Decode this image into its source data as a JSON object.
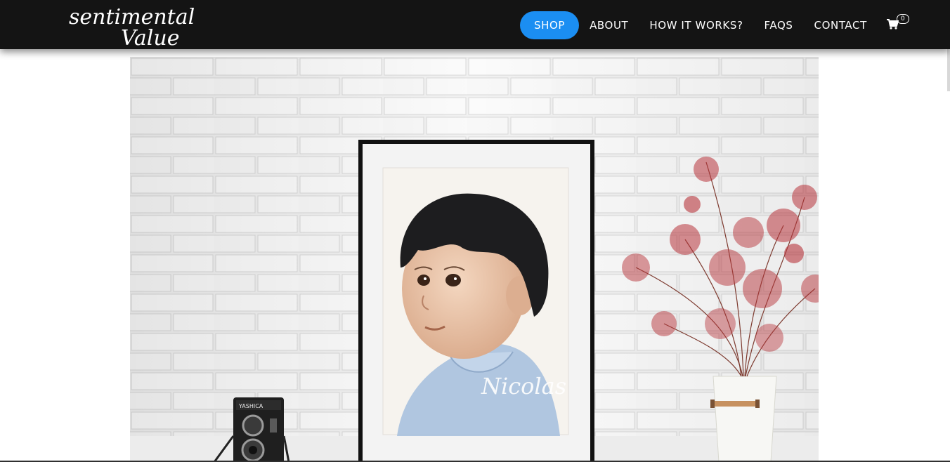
{
  "brand": {
    "logo_line1": "sentimental",
    "logo_line2": "Value"
  },
  "nav": {
    "items": [
      {
        "label": "SHOP",
        "active": true
      },
      {
        "label": "ABOUT",
        "active": false
      },
      {
        "label": "HOW IT WORKS?",
        "active": false
      },
      {
        "label": "FAQS",
        "active": false
      },
      {
        "label": "CONTACT",
        "active": false
      }
    ],
    "cart": {
      "icon": "cart-icon",
      "count": "0"
    }
  },
  "hero": {
    "signature": "Nicolas",
    "camera_brand": "YASHICA",
    "image_description_icon": "framed-watercolor-portrait"
  },
  "colors": {
    "navbar_bg": "#141414",
    "active_pill": "#1b8ef2",
    "nav_text": "#ffffff",
    "flowers": "#b8353c"
  }
}
